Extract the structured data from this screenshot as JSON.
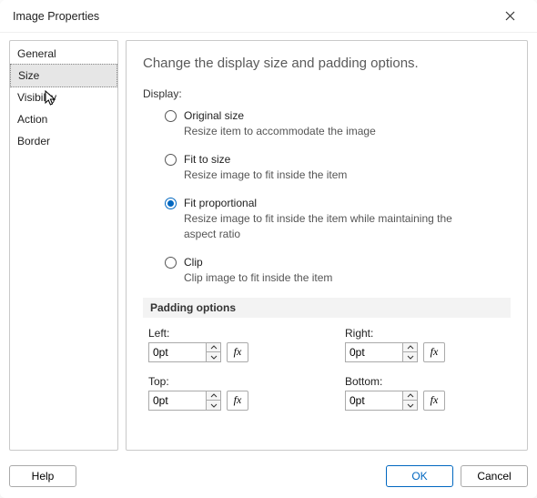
{
  "window": {
    "title": "Image Properties"
  },
  "sidebar": {
    "items": [
      {
        "label": "General",
        "selected": false
      },
      {
        "label": "Size",
        "selected": true
      },
      {
        "label": "Visibility",
        "selected": false,
        "has_cursor": true
      },
      {
        "label": "Action",
        "selected": false
      },
      {
        "label": "Border",
        "selected": false
      }
    ]
  },
  "content": {
    "heading": "Change the display size and padding options.",
    "display_label": "Display:",
    "display_options": [
      {
        "key": "original",
        "label": "Original size",
        "desc": "Resize item to accommodate the image",
        "checked": false
      },
      {
        "key": "fit",
        "label": "Fit to size",
        "desc": "Resize image to fit inside the item",
        "checked": false
      },
      {
        "key": "proportional",
        "label": "Fit proportional",
        "desc": "Resize image to fit inside the item while maintaining the aspect ratio",
        "checked": true
      },
      {
        "key": "clip",
        "label": "Clip",
        "desc": "Clip image to fit inside the item",
        "checked": false
      }
    ],
    "padding_header": "Padding options",
    "padding": {
      "left": {
        "label": "Left:",
        "value": "0pt"
      },
      "right": {
        "label": "Right:",
        "value": "0pt"
      },
      "top": {
        "label": "Top:",
        "value": "0pt"
      },
      "bottom": {
        "label": "Bottom:",
        "value": "0pt"
      }
    },
    "fx_label": "fx"
  },
  "footer": {
    "help": "Help",
    "ok": "OK",
    "cancel": "Cancel"
  }
}
